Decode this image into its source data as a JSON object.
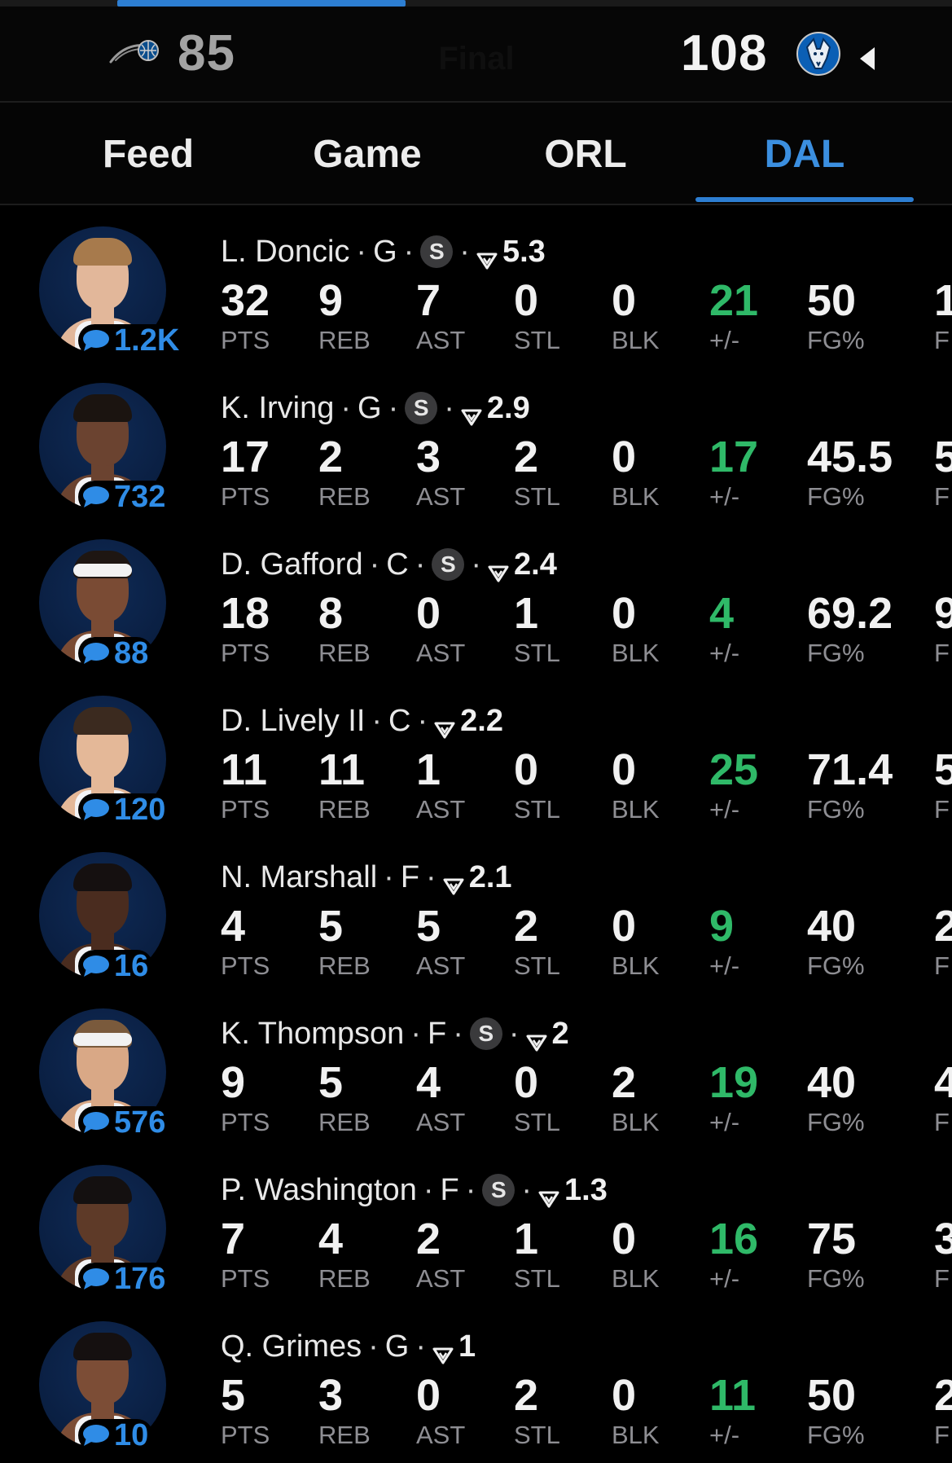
{
  "scoreboard": {
    "away": {
      "abbr": "ORL",
      "score": "85",
      "logo_icon": "magic-logo-icon"
    },
    "home": {
      "abbr": "DAL",
      "score": "108",
      "logo_icon": "mavericks-logo-icon"
    },
    "status": "Final",
    "accent_color": "#2d7ed2"
  },
  "tabs": [
    {
      "label": "Feed"
    },
    {
      "label": "Game"
    },
    {
      "label": "ORL"
    },
    {
      "label": "DAL",
      "active": true
    }
  ],
  "stat_labels": {
    "pts": "PTS",
    "reb": "REB",
    "ast": "AST",
    "stl": "STL",
    "blk": "BLK",
    "pm": "+/-",
    "fg": "FG%",
    "next": "F"
  },
  "players": [
    {
      "name": "L. Doncic",
      "pos": "G",
      "starter": true,
      "rating": "5.3",
      "comments": "1.2K",
      "pts": "32",
      "reb": "9",
      "ast": "7",
      "stl": "0",
      "blk": "0",
      "pm": "21",
      "fg": "50",
      "next": "1"
    },
    {
      "name": "K. Irving",
      "pos": "G",
      "starter": true,
      "rating": "2.9",
      "comments": "732",
      "pts": "17",
      "reb": "2",
      "ast": "3",
      "stl": "2",
      "blk": "0",
      "pm": "17",
      "fg": "45.5",
      "next": "5"
    },
    {
      "name": "D. Gafford",
      "pos": "C",
      "starter": true,
      "rating": "2.4",
      "comments": "88",
      "pts": "18",
      "reb": "8",
      "ast": "0",
      "stl": "1",
      "blk": "0",
      "pm": "4",
      "fg": "69.2",
      "next": "9"
    },
    {
      "name": "D. Lively II",
      "pos": "C",
      "starter": false,
      "rating": "2.2",
      "comments": "120",
      "pts": "11",
      "reb": "11",
      "ast": "1",
      "stl": "0",
      "blk": "0",
      "pm": "25",
      "fg": "71.4",
      "next": "5"
    },
    {
      "name": "N. Marshall",
      "pos": "F",
      "starter": false,
      "rating": "2.1",
      "comments": "16",
      "pts": "4",
      "reb": "5",
      "ast": "5",
      "stl": "2",
      "blk": "0",
      "pm": "9",
      "fg": "40",
      "next": "2"
    },
    {
      "name": "K. Thompson",
      "pos": "F",
      "starter": true,
      "rating": "2",
      "comments": "576",
      "pts": "9",
      "reb": "5",
      "ast": "4",
      "stl": "0",
      "blk": "2",
      "pm": "19",
      "fg": "40",
      "next": "4"
    },
    {
      "name": "P. Washington",
      "pos": "F",
      "starter": true,
      "rating": "1.3",
      "comments": "176",
      "pts": "7",
      "reb": "4",
      "ast": "2",
      "stl": "1",
      "blk": "0",
      "pm": "16",
      "fg": "75",
      "next": "3"
    },
    {
      "name": "Q. Grimes",
      "pos": "G",
      "starter": false,
      "rating": "1",
      "comments": "10",
      "pts": "5",
      "reb": "3",
      "ast": "0",
      "stl": "2",
      "blk": "0",
      "pm": "11",
      "fg": "50",
      "next": "2"
    }
  ],
  "starter_badge_label": "S",
  "colors": {
    "positive": "#2fb968",
    "comment_blue": "#2f8ce6",
    "tab_active": "#3b8fe0"
  }
}
